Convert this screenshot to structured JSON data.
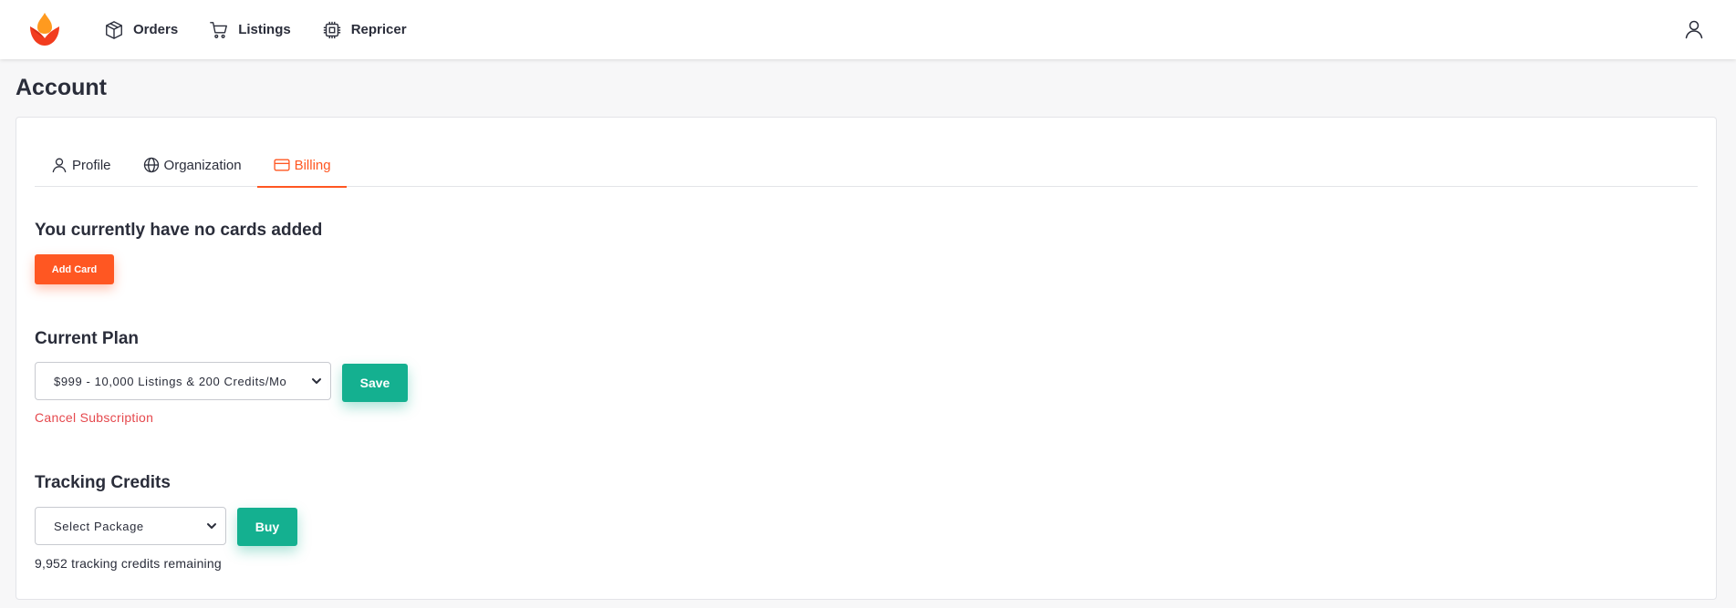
{
  "nav": {
    "items": [
      {
        "label": "Orders",
        "icon": "package-icon"
      },
      {
        "label": "Listings",
        "icon": "cart-icon"
      },
      {
        "label": "Repricer",
        "icon": "chip-icon"
      }
    ]
  },
  "page": {
    "title": "Account"
  },
  "tabs": [
    {
      "label": "Profile",
      "icon": "user-icon"
    },
    {
      "label": "Organization",
      "icon": "globe-icon"
    },
    {
      "label": "Billing",
      "icon": "credit-card-icon",
      "active": true
    }
  ],
  "billing": {
    "cards_heading": "You currently have no cards added",
    "add_card_label": "Add Card",
    "plan_heading": "Current Plan",
    "plan_selected": "$999 - 10,000 Listings & 200 Credits/Mo",
    "save_label": "Save",
    "cancel_label": "Cancel Subscription",
    "credits_heading": "Tracking Credits",
    "package_selected": "Select Package",
    "buy_label": "Buy",
    "credits_remaining": "9,952 tracking credits remaining"
  },
  "colors": {
    "accent": "#ff5722",
    "success": "#14b090",
    "danger": "#e5484d",
    "text": "#2a2d3a"
  }
}
